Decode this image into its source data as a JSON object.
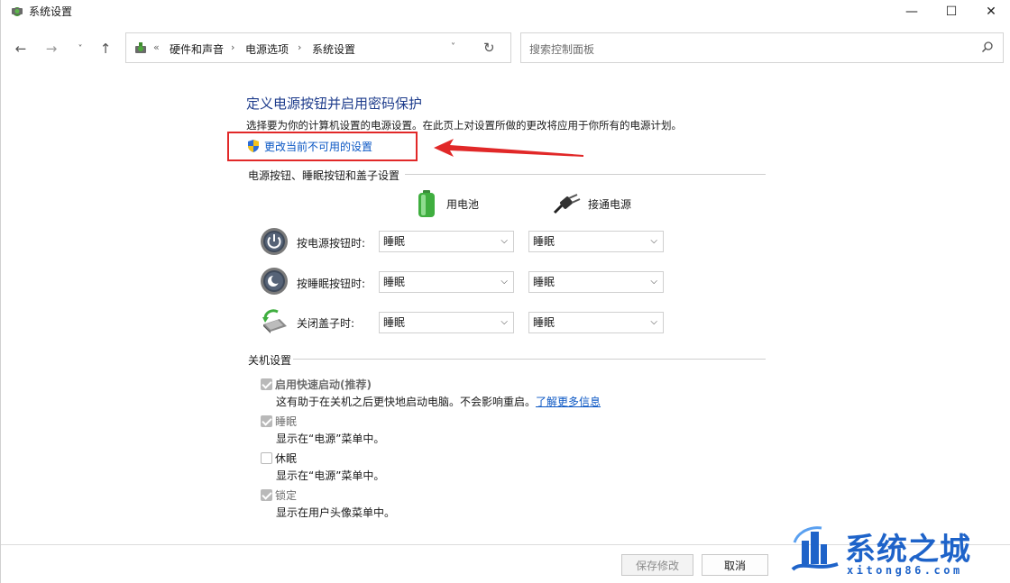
{
  "window": {
    "title": "系统设置",
    "minimize_glyph": "—",
    "maximize_glyph": "☐",
    "close_glyph": "✕"
  },
  "nav": {
    "back_glyph": "←",
    "forward_glyph": "→",
    "recent_glyph": "˅",
    "up_glyph": "↑",
    "crumb_prefix": "«",
    "breadcrumb": [
      "硬件和声音",
      "电源选项",
      "系统设置"
    ],
    "crumb_separator": "›",
    "dropdown_glyph": "˅",
    "refresh_glyph": "↻",
    "search_placeholder": "搜索控制面板"
  },
  "main": {
    "heading": "定义电源按钮并启用密码保护",
    "description": "选择要为你的计算机设置的电源设置。在此页上对设置所做的更改将应用于你所有的电源计划。",
    "change_link": "更改当前不可用的设置",
    "section_buttons": "电源按钮、睡眠按钮和盖子设置",
    "col_battery": "用电池",
    "col_plugged": "接通电源",
    "rows": [
      {
        "label": "按电源按钮时:",
        "battery": "睡眠",
        "plugged": "睡眠",
        "icon": "power-icon"
      },
      {
        "label": "按睡眠按钮时:",
        "battery": "睡眠",
        "plugged": "睡眠",
        "icon": "sleep-icon"
      },
      {
        "label": "关闭盖子时:",
        "battery": "睡眠",
        "plugged": "睡眠",
        "icon": "laptop-lid-icon"
      }
    ],
    "section_shutdown": "关机设置",
    "shutdown": {
      "fast_startup_label": "启用快速启动(推荐)",
      "fast_startup_desc": "这有助于在关机之后更快地启动电脑。不会影响重启。",
      "learn_more": "了解更多信息",
      "sleep_label": "睡眠",
      "sleep_desc": "显示在“电源”菜单中。",
      "hibernate_label": "休眠",
      "hibernate_desc": "显示在“电源”菜单中。",
      "lock_label": "锁定",
      "lock_desc": "显示在用户头像菜单中。"
    }
  },
  "footer": {
    "save_label": "保存修改",
    "cancel_label": "取消"
  },
  "watermark": {
    "text": "系统之城",
    "url": "xitong86.com"
  },
  "colors": {
    "heading": "#1e3c8c",
    "link": "#0b57c4",
    "highlight": "#e12828",
    "watermark": "#1e63c9"
  }
}
